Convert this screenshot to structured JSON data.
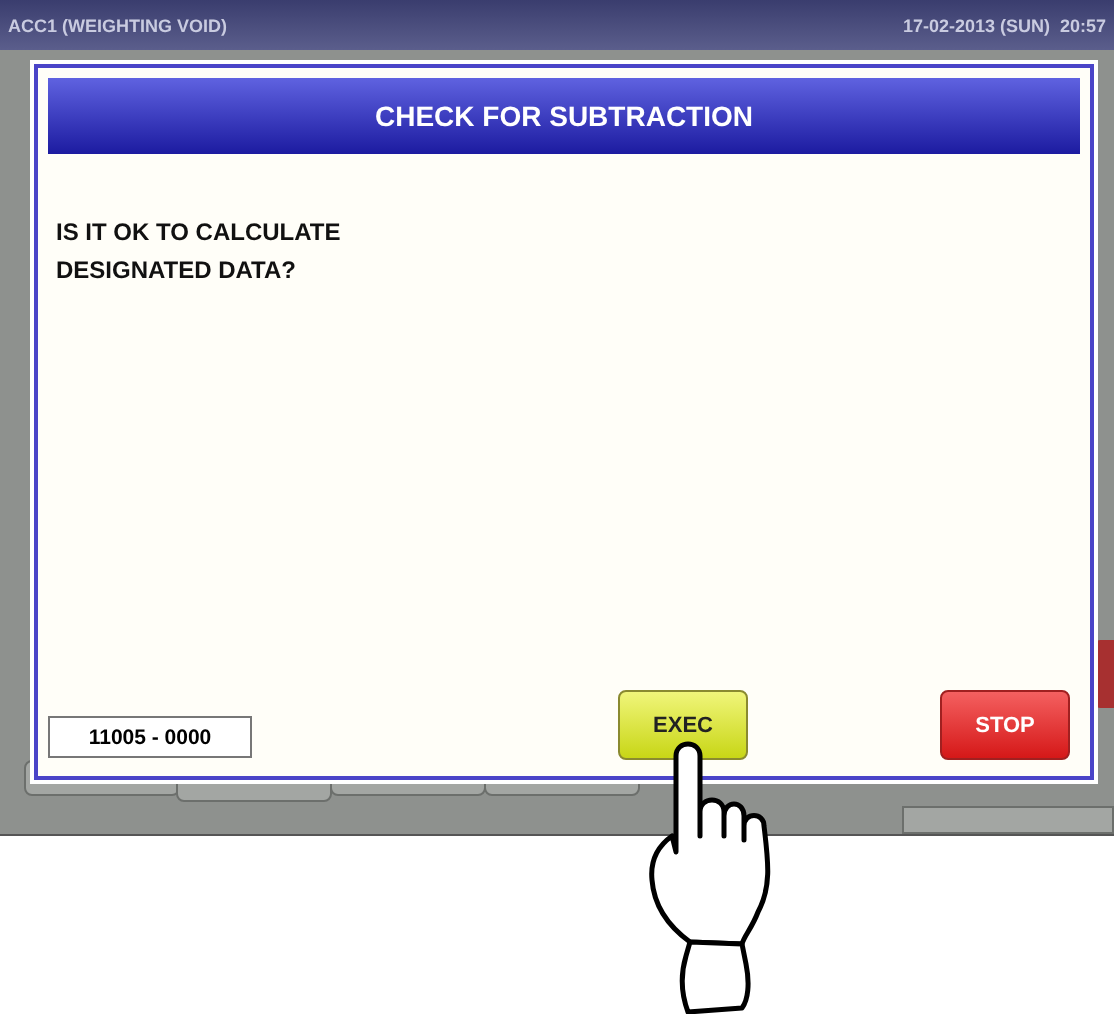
{
  "status_bar": {
    "title": "ACC1 (WEIGHTING VOID)",
    "datetime": "17-02-2013 (SUN)  20:57"
  },
  "dialog": {
    "title": "CHECK FOR SUBTRACTION",
    "message": "IS IT OK TO CALCULATE\nDESIGNATED DATA?",
    "code": "11005 - 0000",
    "buttons": [
      {
        "label": "EXEC",
        "kind": "exec"
      },
      {
        "label": "STOP",
        "kind": "stop"
      }
    ]
  }
}
